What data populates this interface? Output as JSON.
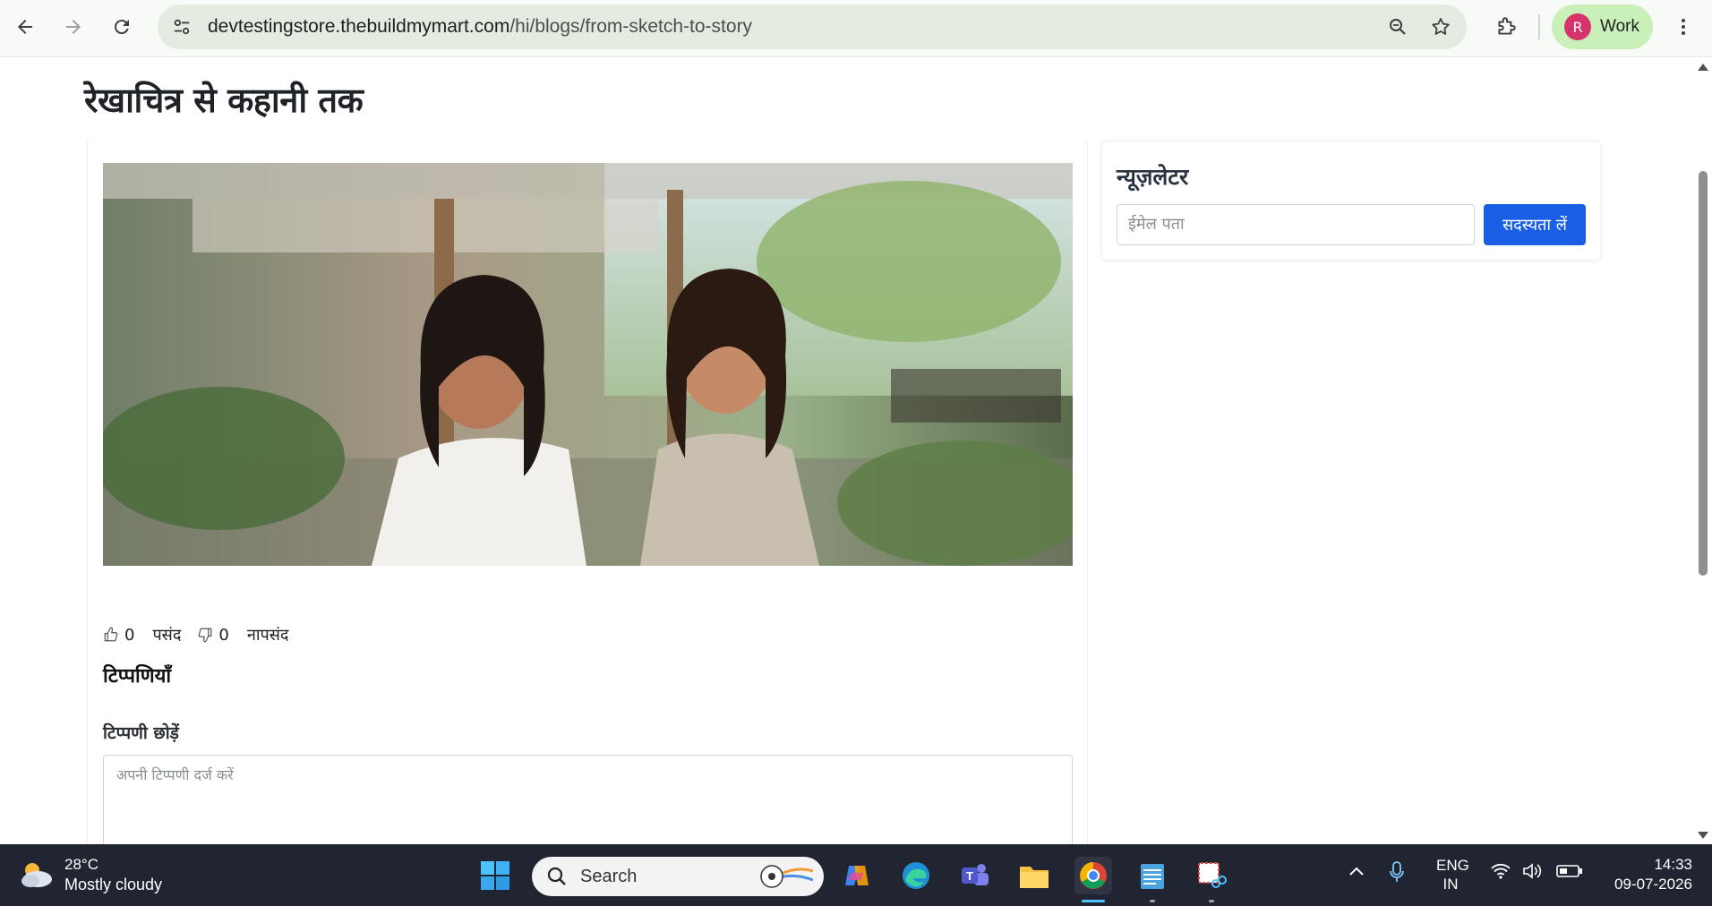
{
  "browser": {
    "url_host": "devtestingstore.thebuildmymart.com",
    "url_path": "/hi/blogs/from-sketch-to-story",
    "profile_initial": "R",
    "profile_label": "Work"
  },
  "page": {
    "title": "रेखाचित्र से कहानी तक",
    "likes_count": "0",
    "likes_label": "पसंद",
    "dislikes_count": "0",
    "dislikes_label": "नापसंद",
    "comments_heading": "टिप्पणियाँ",
    "leave_comment_label": "टिप्पणी छोड़ें",
    "comment_placeholder": "अपनी टिप्पणी दर्ज करें"
  },
  "newsletter": {
    "title": "न्यूज़लेटर",
    "email_placeholder": "ईमेल पता",
    "subscribe_label": "सदस्यता लें"
  },
  "taskbar": {
    "weather_temp": "28°C",
    "weather_desc": "Mostly cloudy",
    "search_label": "Search",
    "lang_top": "ENG",
    "lang_bottom": "IN",
    "time": "14:33",
    "date": "09-07-2026"
  },
  "colors": {
    "accent": "#1a5ee6",
    "profile_bg": "#c9f0b8",
    "taskbar_bg": "#202531"
  }
}
